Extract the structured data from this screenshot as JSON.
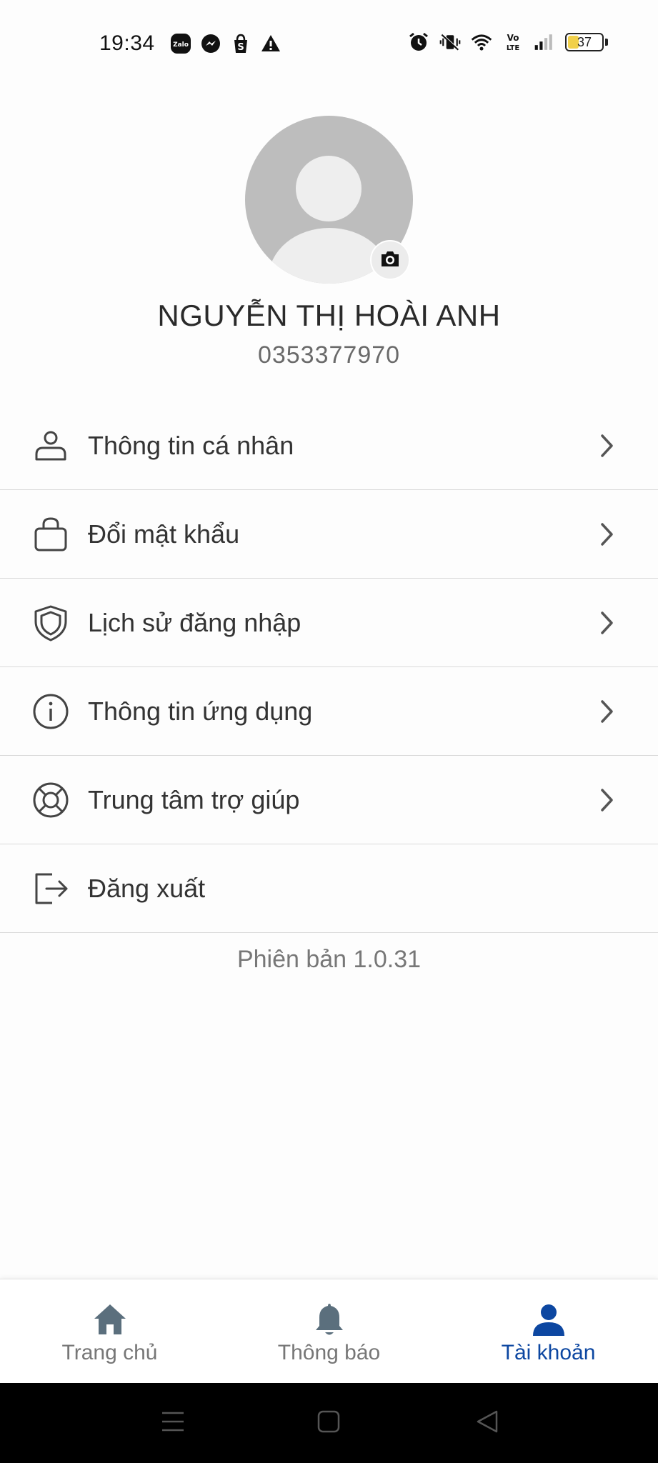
{
  "status_bar": {
    "time": "19:34",
    "left_icons": [
      "zalo-icon",
      "messenger-icon",
      "shopee-icon",
      "warning-icon"
    ],
    "right_icons": [
      "alarm-icon",
      "vibrate-off-icon",
      "wifi-icon",
      "volte-icon",
      "signal-icon",
      "battery-icon"
    ],
    "volte_label_top": "Vo",
    "volte_label_bottom": "LTE",
    "zalo_label": "Zalo",
    "battery_level": "37",
    "battery_fraction": 0.37
  },
  "profile": {
    "name": "NGUYỄN THỊ HOÀI ANH",
    "phone": "0353377970"
  },
  "menu": {
    "items": [
      {
        "label": "Thông tin cá nhân",
        "icon": "user-icon"
      },
      {
        "label": "Đổi mật khẩu",
        "icon": "lock-icon"
      },
      {
        "label": "Lịch sử đăng nhập",
        "icon": "shield-icon"
      },
      {
        "label": "Thông tin ứng dụng",
        "icon": "info-icon"
      },
      {
        "label": "Trung tâm trợ giúp",
        "icon": "lifebuoy-icon"
      },
      {
        "label": "Đăng xuất",
        "icon": "logout-icon"
      }
    ]
  },
  "version_text": "Phiên bản 1.0.31",
  "bottom_nav": {
    "tabs": [
      {
        "label": "Trang chủ",
        "icon": "home-icon",
        "active": false
      },
      {
        "label": "Thông báo",
        "icon": "bell-icon",
        "active": false
      },
      {
        "label": "Tài khoản",
        "icon": "account-icon",
        "active": true
      }
    ]
  },
  "colors": {
    "accent": "#0d47a1",
    "inactive_icon": "#5b6f7d",
    "divider": "#d9d9d9",
    "battery_fill": "#f1d04a"
  }
}
